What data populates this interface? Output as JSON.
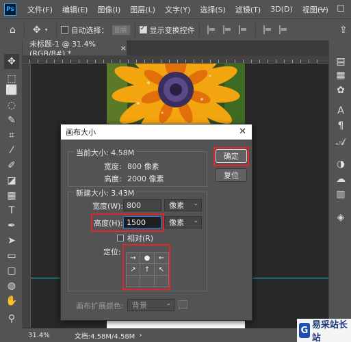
{
  "app": {
    "logo": "Ps"
  },
  "menu": [
    "文件(F)",
    "编辑(E)",
    "图像(I)",
    "图层(L)",
    "文字(Y)",
    "选择(S)",
    "滤镜(T)",
    "3D(D)",
    "视图(V)"
  ],
  "window_controls": {
    "minimize": "—",
    "maximize": "☐"
  },
  "options": {
    "auto_select_label": "自动选择：",
    "auto_select_target": "图层",
    "show_transform_label": "显示变换控件"
  },
  "document": {
    "tab_title": "未标题-1 @ 31.4%(RGB/8#) *",
    "tab_close": "×"
  },
  "status": {
    "zoom": "31.4%",
    "doc_info": "文档:4.58M/4.58M"
  },
  "dialog": {
    "title": "画布大小",
    "close": "✕",
    "current_size_label": "当前大小: 4.58M",
    "current_width_label": "宽度:",
    "current_width_value": "800 像素",
    "current_height_label": "高度:",
    "current_height_value": "2000 像素",
    "new_size_label": "新建大小: 3.43M",
    "width_label": "宽度(W):",
    "width_value": "800",
    "width_unit": "像素",
    "height_label": "高度(H):",
    "height_value": "1500",
    "height_unit": "像素",
    "relative_label": "相对(R)",
    "anchor_label": "定位:",
    "anchor_arrows": [
      "→",
      "",
      "←",
      "↗",
      "↑",
      "↖",
      "",
      "",
      ""
    ],
    "anchor_center": "●",
    "ok_button": "确定",
    "reset_button": "复位",
    "ext_color_label": "画布扩展颜色:",
    "ext_color_value": "背景"
  },
  "watermark": {
    "logo": "G",
    "text": "易采站长站"
  },
  "colors": {
    "highlight": "#e0262c",
    "guide": "#35c6e0"
  }
}
